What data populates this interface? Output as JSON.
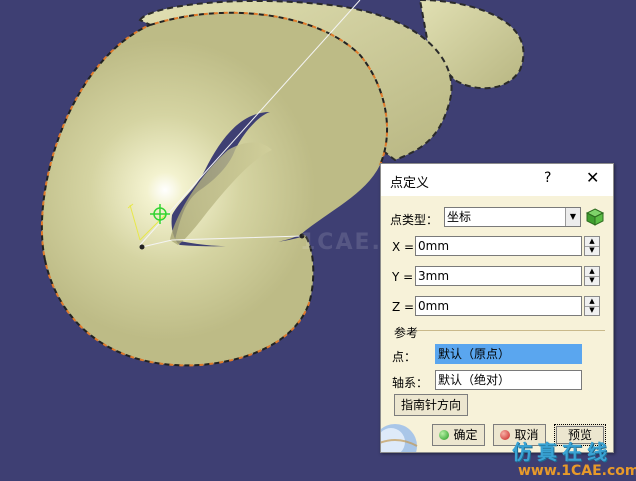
{
  "dialog": {
    "title": "点定义",
    "help_label": "?",
    "close_label": "✕",
    "point_type_label": "点类型：",
    "point_type_value": "坐标",
    "x_label": "X =",
    "x_value": "0mm",
    "y_label": "Y =",
    "y_value": "3mm",
    "z_label": "Z =",
    "z_value": "0mm",
    "reference_label": "参考",
    "point_label": "点：",
    "point_value": "默认（原点）",
    "axis_label": "轴系：",
    "axis_value": "默认（绝对）",
    "compass_button": "指南针方向",
    "ok_button": "确定",
    "cancel_button": "取消",
    "preview_button": "预览"
  },
  "watermark": {
    "text": "仿真在线",
    "url": "www.1CAE.com",
    "faint_text": "1CAE.COM"
  },
  "colors": {
    "viewport_background": "#3e3f73",
    "surface": "#d4d3a0",
    "edge_orange": "#e07a2a",
    "dialog_background": "#f7f2d9",
    "selected_field": "#5aa6ef"
  },
  "icons": {
    "ok": "green-dot-icon",
    "cancel": "red-dot-icon",
    "point_type": "green-cube-icon"
  }
}
